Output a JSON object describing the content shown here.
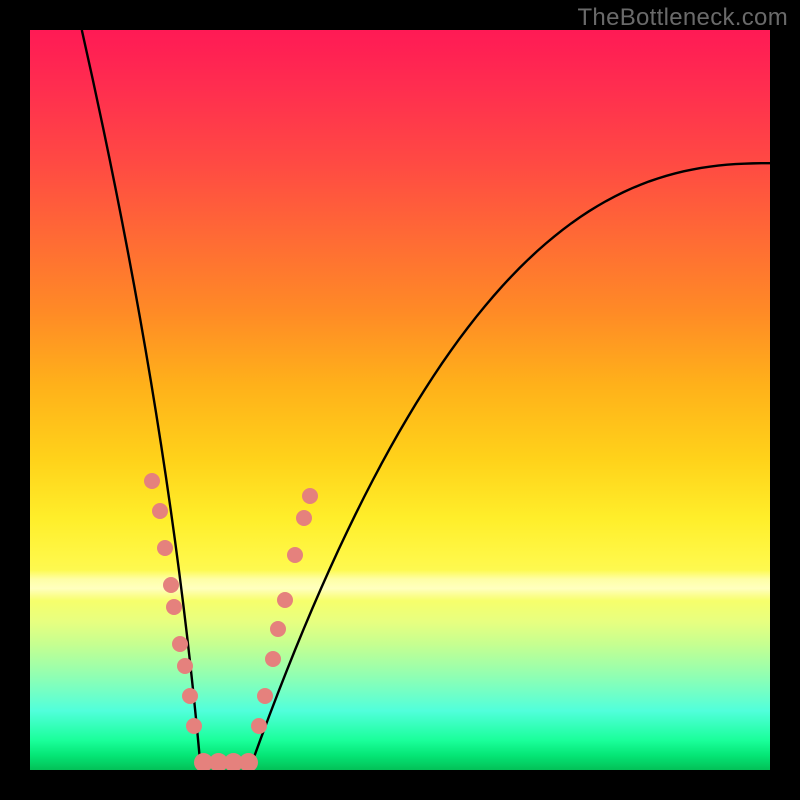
{
  "watermark": {
    "text": "TheBottleneck.com"
  },
  "chart_data": {
    "type": "line",
    "title": "",
    "xlabel": "",
    "ylabel": "",
    "xlim": [
      0,
      100
    ],
    "ylim": [
      0,
      100
    ],
    "grid": false,
    "legend": false,
    "colors": {
      "curve": "#000000",
      "point": "#e5817d",
      "background_top": "#ff1a55",
      "background_mid": "#ffee2a",
      "background_bottom": "#03c057"
    },
    "series": [
      {
        "name": "bottleneck-curve",
        "kind": "v-curve",
        "left_branch": {
          "x0": 7,
          "y0": 100,
          "x1": 23,
          "y1": 1
        },
        "floor": {
          "x0": 23,
          "x1": 30,
          "y": 1
        },
        "right_branch": {
          "x0": 30,
          "y0": 1,
          "x1": 100,
          "y1": 82,
          "shape": "concave"
        }
      }
    ],
    "data_points_left": [
      {
        "x": 16.5,
        "y": 39
      },
      {
        "x": 17.5,
        "y": 35
      },
      {
        "x": 18.2,
        "y": 30
      },
      {
        "x": 19.0,
        "y": 25
      },
      {
        "x": 19.4,
        "y": 22
      },
      {
        "x": 20.3,
        "y": 17
      },
      {
        "x": 20.9,
        "y": 14
      },
      {
        "x": 21.6,
        "y": 10
      },
      {
        "x": 22.2,
        "y": 6
      }
    ],
    "data_points_floor": [
      {
        "x": 23.5,
        "y": 1
      },
      {
        "x": 25.5,
        "y": 1
      },
      {
        "x": 27.5,
        "y": 1
      },
      {
        "x": 29.5,
        "y": 1
      }
    ],
    "data_points_right": [
      {
        "x": 31.0,
        "y": 6
      },
      {
        "x": 31.8,
        "y": 10
      },
      {
        "x": 32.8,
        "y": 15
      },
      {
        "x": 33.5,
        "y": 19
      },
      {
        "x": 34.4,
        "y": 23
      },
      {
        "x": 35.8,
        "y": 29
      },
      {
        "x": 37.0,
        "y": 34
      },
      {
        "x": 37.8,
        "y": 37
      }
    ]
  }
}
